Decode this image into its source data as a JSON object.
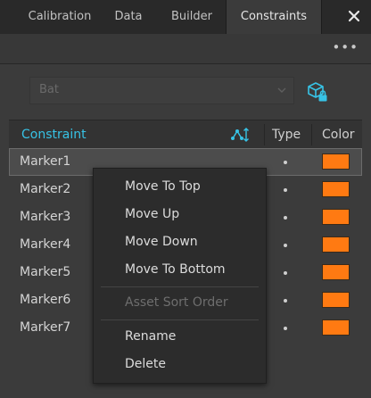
{
  "tabs": [
    {
      "label": "Calibration",
      "active": false
    },
    {
      "label": "Data",
      "active": false
    },
    {
      "label": "Builder",
      "active": false
    },
    {
      "label": "Constraints",
      "active": true
    }
  ],
  "toolbar": {
    "more_label": "•••"
  },
  "asset_selector": {
    "value": "Bat"
  },
  "table": {
    "headers": {
      "constraint": "Constraint",
      "type": "Type",
      "color": "Color"
    },
    "rows": [
      {
        "name": "Marker1",
        "type": "•",
        "color": "#ff7a12",
        "selected": true
      },
      {
        "name": "Marker2",
        "type": "•",
        "color": "#ff7a12",
        "selected": false
      },
      {
        "name": "Marker3",
        "type": "•",
        "color": "#ff7a12",
        "selected": false
      },
      {
        "name": "Marker4",
        "type": "•",
        "color": "#ff7a12",
        "selected": false
      },
      {
        "name": "Marker5",
        "type": "•",
        "color": "#ff7a12",
        "selected": false
      },
      {
        "name": "Marker6",
        "type": "•",
        "color": "#ff7a12",
        "selected": false
      },
      {
        "name": "Marker7",
        "type": "•",
        "color": "#ff7a12",
        "selected": false
      }
    ]
  },
  "context_menu": {
    "items": [
      {
        "label": "Move To Top",
        "enabled": true
      },
      {
        "label": "Move Up",
        "enabled": true
      },
      {
        "label": "Move Down",
        "enabled": true
      },
      {
        "label": "Move To Bottom",
        "enabled": true
      },
      {
        "label": "Asset Sort Order",
        "enabled": false
      },
      {
        "label": "Rename",
        "enabled": true
      },
      {
        "label": "Delete",
        "enabled": true
      }
    ]
  },
  "colors": {
    "accent": "#37c3e6",
    "marker": "#ff7a12"
  }
}
